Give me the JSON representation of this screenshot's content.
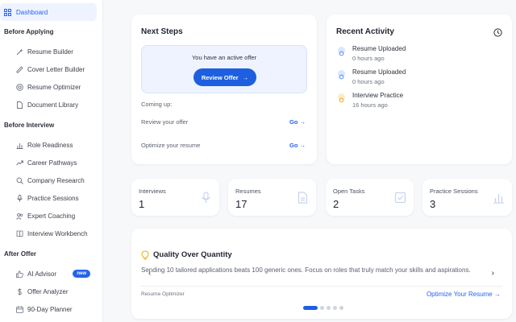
{
  "sidebar": {
    "dashboard": "Dashboard",
    "sections": [
      {
        "title": "Before Applying",
        "items": [
          {
            "label": "Resume Builder",
            "icon": "magic-wand-icon"
          },
          {
            "label": "Cover Letter Builder",
            "icon": "pencil-icon"
          },
          {
            "label": "Resume Optimizer",
            "icon": "target-icon"
          },
          {
            "label": "Document Library",
            "icon": "document-icon"
          }
        ]
      },
      {
        "title": "Before Interview",
        "items": [
          {
            "label": "Role Readiness",
            "icon": "bar-chart-icon"
          },
          {
            "label": "Career Pathways",
            "icon": "trend-icon"
          },
          {
            "label": "Company Research",
            "icon": "search-icon"
          },
          {
            "label": "Practice Sessions",
            "icon": "microphone-icon"
          },
          {
            "label": "Expert Coaching",
            "icon": "users-icon"
          },
          {
            "label": "Interview Workbench",
            "icon": "book-icon"
          }
        ]
      },
      {
        "title": "After Offer",
        "items": [
          {
            "label": "AI Advisor",
            "icon": "thumbs-up-icon",
            "badge": "new"
          },
          {
            "label": "Offer Analyzer",
            "icon": "dollar-icon"
          },
          {
            "label": "90-Day Planner",
            "icon": "calendar-icon"
          }
        ]
      }
    ]
  },
  "next_steps": {
    "title": "Next Steps",
    "offer_text": "You have an active offer",
    "offer_button": "Review Offer",
    "coming_up": "Coming up:",
    "tasks": [
      {
        "label": "Review your offer",
        "action": "Go"
      },
      {
        "label": "Optimize your resume",
        "action": "Go"
      }
    ]
  },
  "recent_activity": {
    "title": "Recent Activity",
    "items": [
      {
        "title": "Resume Uploaded",
        "time": "0 hours ago",
        "color": "#3b82f6"
      },
      {
        "title": "Resume Uploaded",
        "time": "0 hours ago",
        "color": "#3b82f6"
      },
      {
        "title": "Interview Practice",
        "time": "16 hours ago",
        "color": "#f59e0b"
      }
    ]
  },
  "stats": [
    {
      "label": "Interviews",
      "value": "1",
      "icon": "microphone-icon"
    },
    {
      "label": "Resumes",
      "value": "17",
      "icon": "document-icon"
    },
    {
      "label": "Open Tasks",
      "value": "2",
      "icon": "checkbox-icon"
    },
    {
      "label": "Practice Sessions",
      "value": "3",
      "icon": "bar-chart-icon"
    }
  ],
  "tip": {
    "title": "Quality Over Quantity",
    "body": "Sending 10 tailored applications beats 100 generic ones. Focus on roles that truly match your skills and aspirations.",
    "source": "Resume Optimizer",
    "cta": "Optimize Your Resume",
    "dots_total": 5,
    "dots_active": 0
  },
  "colors": {
    "accent": "#1d5fe0",
    "activity_blue": "#3b82f6",
    "activity_orange": "#f59e0b",
    "stat_icon": "#c7d3ee"
  }
}
